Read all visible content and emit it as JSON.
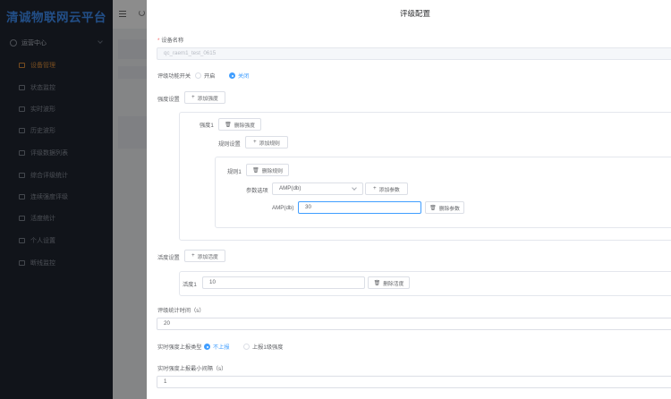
{
  "app": {
    "brand": "清诚物联网云平台"
  },
  "sidebar": {
    "group": "运营中心",
    "items": [
      {
        "label": "设备管理",
        "active": true
      },
      {
        "label": "状态监控"
      },
      {
        "label": "实时波形"
      },
      {
        "label": "历史波形"
      },
      {
        "label": "评级数据列表"
      },
      {
        "label": "综合评级统计"
      },
      {
        "label": "连续强度评级"
      },
      {
        "label": "活度统计"
      },
      {
        "label": "个人设置"
      },
      {
        "label": "断线监控"
      }
    ]
  },
  "drawer": {
    "title": "评级配置",
    "device_name_label": "设备名称",
    "device_name_value": "qc_raem1_test_0615",
    "switch_label": "评级功能开关",
    "switch_on": "开启",
    "switch_off": "关闭",
    "switch_selected": "关闭",
    "intensity_label": "强度设置",
    "add_intensity": "添加强度",
    "intensity_name": "强度1",
    "delete_intensity": "删除强度",
    "rule_label": "规则设置",
    "add_rule": "添加规则",
    "rule_name": "规则1",
    "delete_rule": "删除规则",
    "param_label": "参数选项",
    "param_selected": "AMP(db)",
    "add_param": "添加参数",
    "param_name": "AMP(db)",
    "param_value": "30",
    "delete_param": "删除参数",
    "activity_label": "活度设置",
    "add_activity": "添加活度",
    "activity_name": "活度1",
    "activity_value": "10",
    "delete_activity": "删除活度",
    "stat_time_label": "评级统计时间（s）",
    "stat_time_value": "20",
    "report_type_label": "实时强度上报类型",
    "report_no": "不上报",
    "report_level1": "上报1级强度",
    "report_selected": "不上报",
    "min_interval_label": "实时强度上报最小间隔（s）",
    "min_interval_value": "1"
  }
}
